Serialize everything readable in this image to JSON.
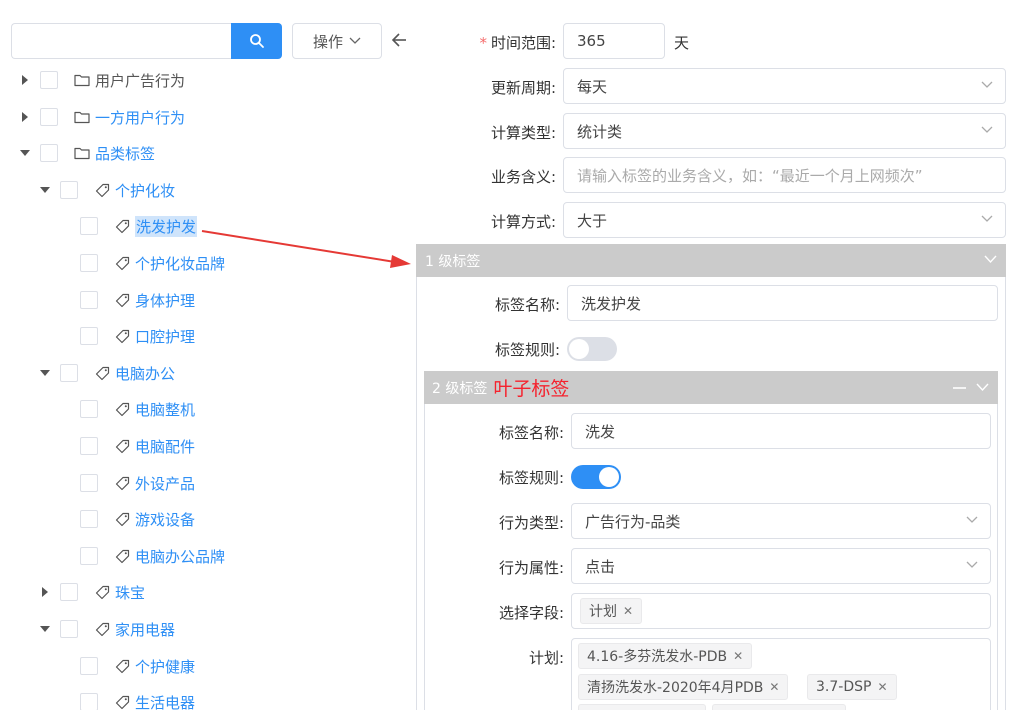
{
  "toolbar": {
    "search_value": "",
    "search_icon": "search-icon",
    "operate_label": "操作",
    "back_icon": "arrow-left-icon"
  },
  "tree": [
    {
      "label": "用户广告行为",
      "level": 0,
      "expanded": false,
      "type": "folder"
    },
    {
      "label": "一方用户行为",
      "level": 0,
      "expanded": false,
      "type": "folder"
    },
    {
      "label": "品类标签",
      "level": 0,
      "expanded": true,
      "type": "folder"
    },
    {
      "label": "个护化妆",
      "level": 1,
      "expanded": true,
      "type": "tag"
    },
    {
      "label": "洗发护发",
      "level": 2,
      "type": "tag",
      "selected": true
    },
    {
      "label": "个护化妆品牌",
      "level": 2,
      "type": "tag"
    },
    {
      "label": "身体护理",
      "level": 2,
      "type": "tag"
    },
    {
      "label": "口腔护理",
      "level": 2,
      "type": "tag"
    },
    {
      "label": "电脑办公",
      "level": 1,
      "expanded": true,
      "type": "tag"
    },
    {
      "label": "电脑整机",
      "level": 2,
      "type": "tag"
    },
    {
      "label": "电脑配件",
      "level": 2,
      "type": "tag"
    },
    {
      "label": "外设产品",
      "level": 2,
      "type": "tag"
    },
    {
      "label": "游戏设备",
      "level": 2,
      "type": "tag"
    },
    {
      "label": "电脑办公品牌",
      "level": 2,
      "type": "tag"
    },
    {
      "label": "珠宝",
      "level": 1,
      "expanded": false,
      "type": "tag"
    },
    {
      "label": "家用电器",
      "level": 1,
      "expanded": true,
      "type": "tag"
    },
    {
      "label": "个护健康",
      "level": 2,
      "type": "tag"
    },
    {
      "label": "生活电器",
      "level": 2,
      "type": "tag"
    }
  ],
  "form": {
    "time_range": {
      "label": "时间范围:",
      "value": "365",
      "unit": "天"
    },
    "update_cycle": {
      "label": "更新周期:",
      "value": "每天"
    },
    "calc_type": {
      "label": "计算类型:",
      "value": "统计类"
    },
    "business_meaning": {
      "label": "业务含义:",
      "placeholder": "请输入标签的业务含义，如：“最近一个月上网频次”"
    },
    "calc_method": {
      "label": "计算方式:",
      "value": "大于"
    }
  },
  "level1": {
    "header": "1 级标签",
    "tag_name_label": "标签名称:",
    "tag_name_value": "洗发护发",
    "tag_rule_label": "标签规则:",
    "tag_rule_on": false
  },
  "level2": {
    "header": "2 级标签",
    "annotation": "叶子标签",
    "tag_name_label": "标签名称:",
    "tag_name_value": "洗发",
    "tag_rule_label": "标签规则:",
    "tag_rule_on": true,
    "behavior_type_label": "行为类型:",
    "behavior_type_value": "广告行为-品类",
    "behavior_attr_label": "行为属性:",
    "behavior_attr_value": "点击",
    "field_select_label": "选择字段:",
    "field_tags": [
      "计划"
    ],
    "plan_label": "计划:",
    "plan_tags": [
      "4.16-多芬洗发水-PDB",
      "清扬洗发水-2020年4月PDB",
      "3.7-DSP"
    ]
  },
  "colors": {
    "primary": "#2e8ff5",
    "required": "#f56c6c",
    "annotation": "#f5222d",
    "panel_header": "#cbcbcb"
  }
}
